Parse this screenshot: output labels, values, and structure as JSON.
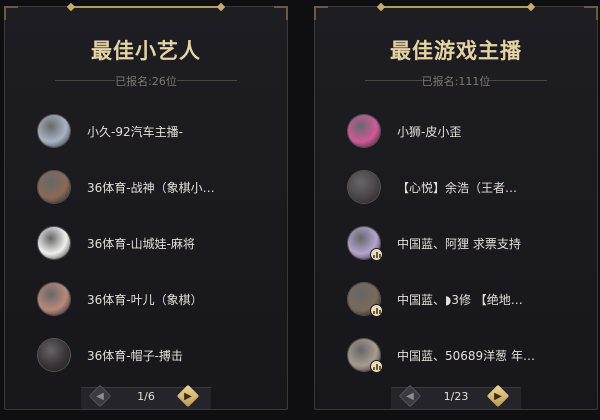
{
  "panels": [
    {
      "title": "最佳小艺人",
      "registered": "已报名:26位",
      "page": "1/6",
      "items": [
        {
          "name": "小久-92汽车主播-",
          "avatar_color": "#a8b4c4",
          "badge": false
        },
        {
          "name": "36体育-战神（象棋小…",
          "avatar_color": "#8a6a55",
          "badge": false
        },
        {
          "name": "36体育-山城娃-麻将",
          "avatar_color": "#f0f0ee",
          "badge": false
        },
        {
          "name": "36体育-叶儿（象棋）",
          "avatar_color": "#b88a7a",
          "badge": false
        },
        {
          "name": "36体育-帽子-搏击",
          "avatar_color": "#3a3238",
          "badge": false
        }
      ]
    },
    {
      "title": "最佳游戏主播",
      "registered": "已报名:111位",
      "page": "1/23",
      "items": [
        {
          "name": "小狮-皮小歪",
          "avatar_color": "#d05a9a",
          "badge": false
        },
        {
          "name": "【心悦】余浩（王者…",
          "avatar_color": "#4a4448",
          "badge": false
        },
        {
          "name": "中国蓝、阿狸 求票支持",
          "avatar_color": "#b4a4d0",
          "badge": true
        },
        {
          "name": "中国蓝、◗3修 【绝地…",
          "avatar_color": "#7a6a5a",
          "badge": true
        },
        {
          "name": "中国蓝、50689洋葱 年…",
          "avatar_color": "#a89c8c",
          "badge": true
        }
      ]
    }
  ],
  "icons": {
    "prev": "chevron-left-icon",
    "next": "chevron-right-icon",
    "badge": "bar-chart-icon"
  },
  "colors": {
    "accent": "#e6d3a4",
    "background": "#0f0f12",
    "panel": "#1a1a1f"
  }
}
